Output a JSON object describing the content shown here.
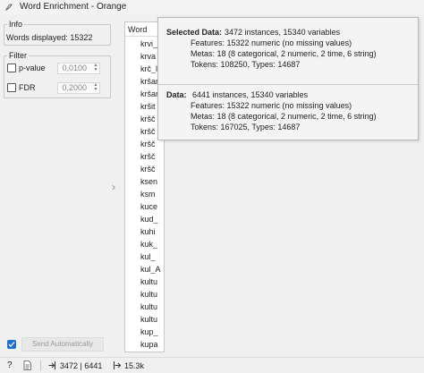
{
  "window": {
    "title": "Word Enrichment - Orange"
  },
  "info": {
    "title": "Info",
    "words_displayed": "Words displayed: 15322"
  },
  "filter": {
    "title": "Filter",
    "pvalue": {
      "label": "p-value",
      "value": "0,0100",
      "checked": false
    },
    "fdr": {
      "label": "FDR",
      "value": "0,2000",
      "checked": false
    }
  },
  "word_list": {
    "header": "Word",
    "items": [
      "krvi_",
      "krva",
      "krč_l",
      "kršan",
      "kršar",
      "kršit",
      "kršč",
      "kršč",
      "kršč",
      "kršč",
      "kršč",
      "ksen",
      "ksm",
      "kuce",
      "kud_",
      "kuhi",
      "kuk_",
      "kul_",
      "kul_A",
      "kultu",
      "kultu",
      "kultu",
      "kultu",
      "kup_",
      "kupa"
    ]
  },
  "tooltip": {
    "selected": {
      "label": "Selected Data:",
      "summary": "3472 instances, 15340 variables",
      "features": "Features: 15322 numeric (no missing values)",
      "metas": "Metas: 18 (8 categorical, 2 numeric, 2 time, 6 string)",
      "tokens": "Tokens: 108250, Types: 14687"
    },
    "data": {
      "label": "Data:",
      "summary": "6441 instances, 15340 variables",
      "features": "Features: 15322 numeric (no missing values)",
      "metas": "Metas: 18 (8 categorical, 2 numeric, 2 time, 6 string)",
      "tokens": "Tokens: 167025, Types: 14687"
    }
  },
  "controls": {
    "send_auto_label": "Send Automatically",
    "send_auto_checked": true
  },
  "statusbar": {
    "data_counts": "3472 | 6441",
    "output_size": "15.3k"
  },
  "colors": {
    "accent": "#1f6fcf"
  }
}
